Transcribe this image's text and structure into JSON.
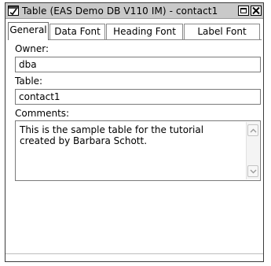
{
  "window": {
    "title": "Table (EAS Demo DB V110 IM) - contact1"
  },
  "tabs": [
    {
      "label": "General",
      "active": true
    },
    {
      "label": "Data Font",
      "active": false
    },
    {
      "label": "Heading Font",
      "active": false
    },
    {
      "label": "Label Font",
      "active": false
    }
  ],
  "form": {
    "owner_label": "Owner:",
    "owner_value": "dba",
    "table_label": "Table:",
    "table_value": "contact1",
    "comments_label": "Comments:",
    "comments_value": "This is the sample table for the tutorial\ncreated by Barbara Schott."
  },
  "icons": {
    "title": "table-icon",
    "maximize": "maximize-icon",
    "close": "close-icon",
    "scroll_up": "scroll-up-icon",
    "scroll_down": "scroll-down-icon"
  },
  "colors": {
    "titlebar": "#c9c9c9",
    "background": "#ffffff",
    "border": "#7a7a7a"
  }
}
